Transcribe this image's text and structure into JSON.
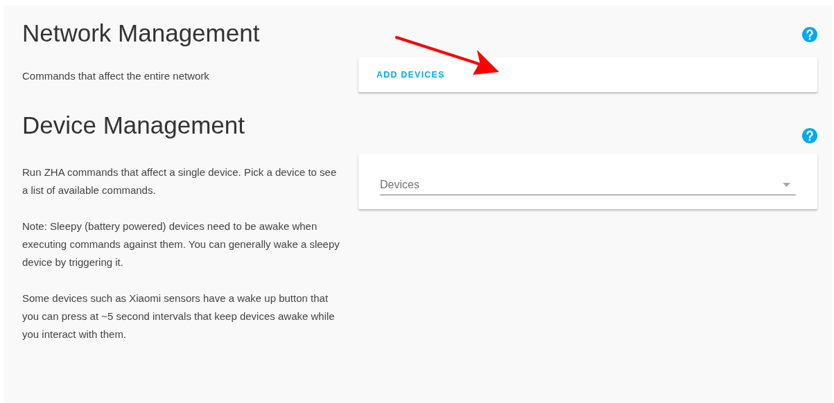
{
  "sections": [
    {
      "title": "Network Management",
      "description": [
        "Commands that affect the entire network"
      ],
      "card": {
        "kind": "button",
        "label": "ADD DEVICES"
      }
    },
    {
      "title": "Device Management",
      "description": [
        "Run ZHA commands that affect a single device. Pick a device to see a list of available commands.",
        "Note: Sleepy (battery powered) devices need to be awake when executing commands against them. You can generally wake a sleepy device by triggering it.",
        "Some devices such as Xiaomi sensors have a wake up button that you can press at ~5 second intervals that keep devices awake while you interact with them."
      ],
      "card": {
        "kind": "dropdown",
        "label": "Devices"
      }
    }
  ]
}
